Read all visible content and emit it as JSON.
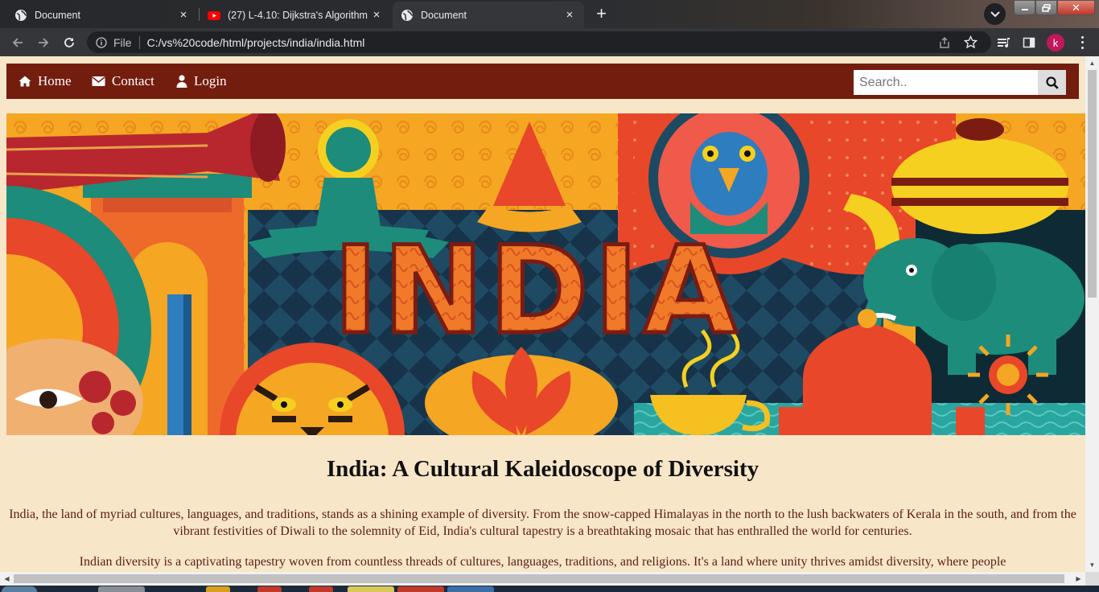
{
  "browser": {
    "tabs": [
      {
        "title": "Document",
        "icon": "globe-icon",
        "active": false
      },
      {
        "title": "(27) L-4.10: Dijkstra's Algorithm -",
        "icon": "youtube-icon",
        "active": false
      },
      {
        "title": "Document",
        "icon": "globe-icon",
        "active": true
      }
    ],
    "close_glyph": "×",
    "new_tab_glyph": "+",
    "address": {
      "scheme_label": "File",
      "url": "C:/vs%20code/html/projects/india/india.html"
    },
    "profile_initial": "k",
    "window_close_glyph": "✕"
  },
  "site": {
    "nav": [
      {
        "label": "Home",
        "icon": "home-icon"
      },
      {
        "label": "Contact",
        "icon": "envelope-icon"
      },
      {
        "label": "Login",
        "icon": "user-icon"
      }
    ],
    "search_placeholder": "Search..",
    "banner_text": "INDIA",
    "title": "India: A Cultural Kaleidoscope of Diversity",
    "paragraphs": [
      "India, the land of myriad cultures, languages, and traditions, stands as a shining example of diversity. From the snow-capped Himalayas in the north to the lush backwaters of Kerala in the south, and from the vibrant festivities of Diwali to the solemnity of Eid, India's cultural tapestry is a breathtaking mosaic that has enthralled the world for centuries.",
      "Indian diversity is a captivating tapestry woven from countless threads of cultures, languages, traditions, and religions. It's a land where unity thrives amidst diversity, where people"
    ]
  },
  "colors": {
    "nav_bg": "#731d0f",
    "page_bg": "#f8e6c9",
    "text": "#5a1c12"
  }
}
